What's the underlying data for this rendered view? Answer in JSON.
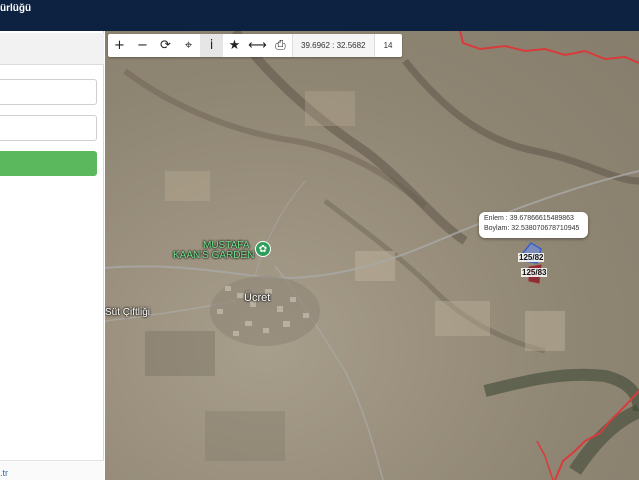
{
  "header": {
    "title": "ürlüğü"
  },
  "sidebar": {
    "footer_text": ".tr"
  },
  "toolbar": {
    "buttons": [
      {
        "name": "zoom-in",
        "glyph": "+"
      },
      {
        "name": "zoom-out",
        "glyph": "−"
      },
      {
        "name": "refresh",
        "glyph": "⟳"
      },
      {
        "name": "locate",
        "glyph": "⌖"
      },
      {
        "name": "info",
        "glyph": "i"
      },
      {
        "name": "favorite",
        "glyph": "★"
      },
      {
        "name": "measure",
        "glyph": "⟷"
      },
      {
        "name": "print",
        "glyph": "⎙"
      }
    ],
    "coordinates": "39.6962 : 32.5682",
    "zoom_level": "14"
  },
  "map": {
    "labels": {
      "garden_line1": "MUSTAFA",
      "garden_line2": "KAAN'S GARDEN",
      "town": "Ücret",
      "farm": "Süt Çiftliği"
    },
    "popup": {
      "lat_label": "Enlem :",
      "lat_value": "39.67866615489863",
      "lon_label": "Boylam:",
      "lon_value": "32.538070678710945"
    },
    "parcels": [
      "125/82",
      "125/83"
    ],
    "colors": {
      "boundary": "#d93a3a",
      "parcel_outline": "#3a63c8",
      "parcel_fill": "#8b1e2a",
      "accent_button": "#5cb85c",
      "header_bg": "#0d2240"
    }
  }
}
